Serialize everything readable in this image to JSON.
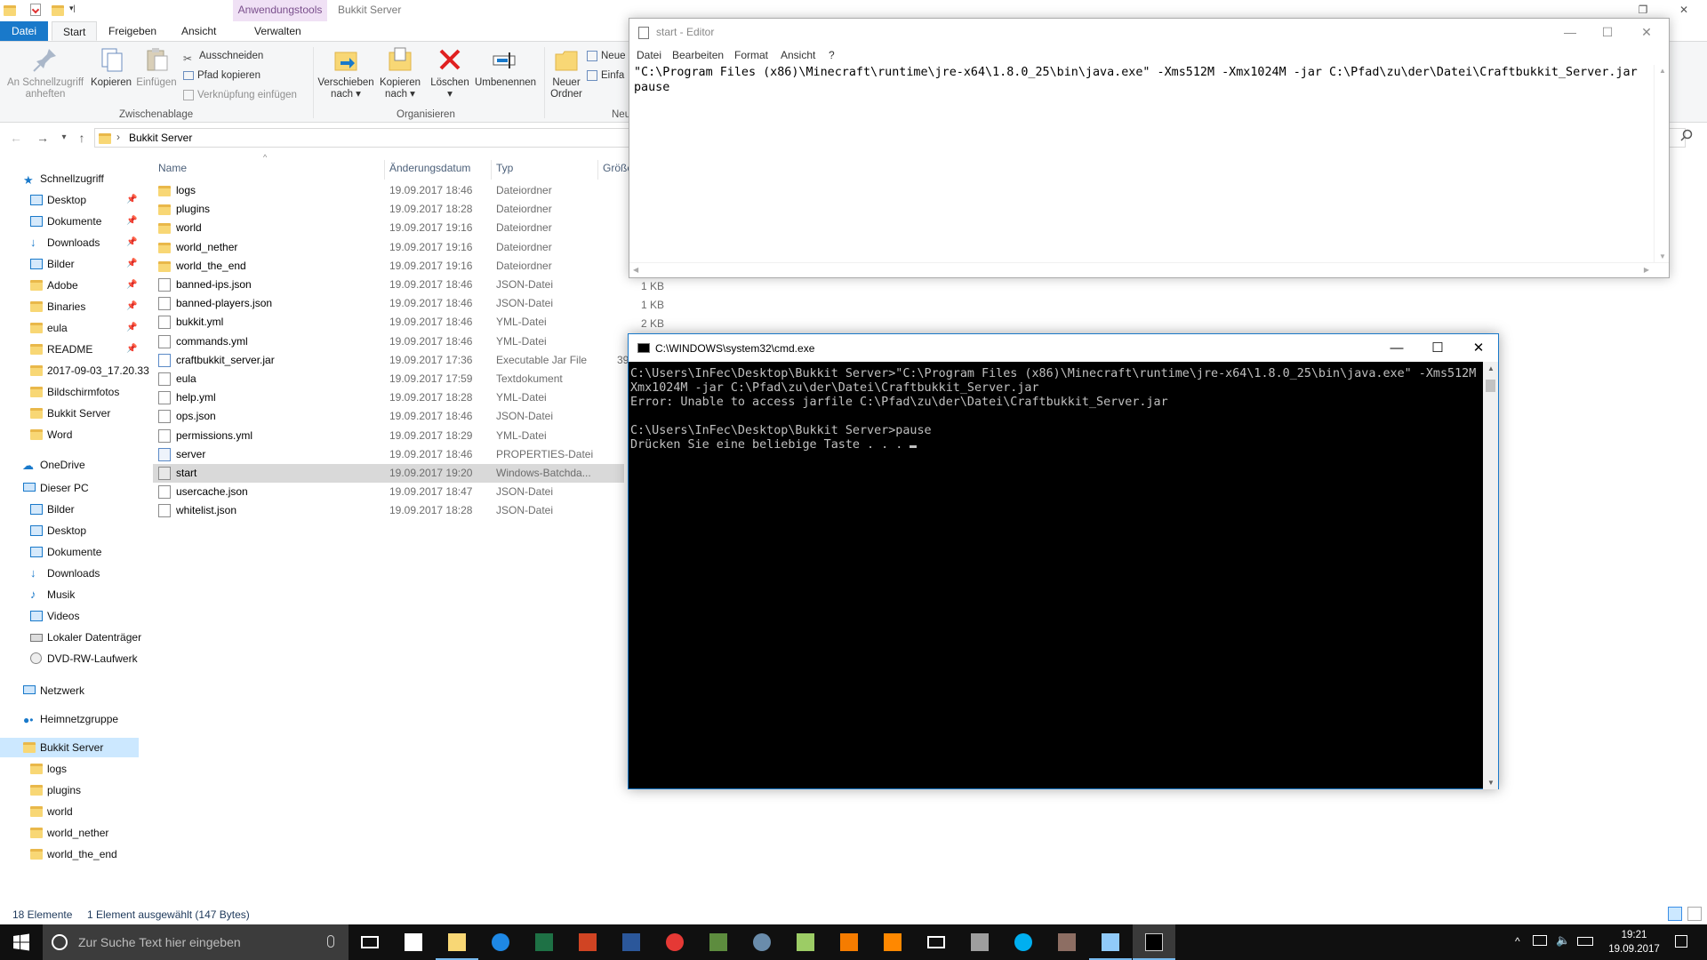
{
  "explorer": {
    "window_title": "Bukkit Server",
    "context_tab": "Anwendungstools",
    "tabs": [
      "Datei",
      "Start",
      "Freigeben",
      "Ansicht",
      "Verwalten"
    ],
    "ribbon": {
      "pin_label": "An Schnellzugriff anheften",
      "copy_label": "Kopieren",
      "paste_label": "Einfügen",
      "cut_label": "Ausschneiden",
      "copy_path_label": "Pfad kopieren",
      "paste_shortcut_label": "Verknüpfung einfügen",
      "group_clipboard": "Zwischenablage",
      "move_label": "Verschieben nach",
      "copyto_label": "Kopieren nach",
      "delete_label": "Löschen",
      "rename_label": "Umbenennen",
      "group_organize": "Organisieren",
      "new_folder_label": "Neuer Ordner",
      "new_item_label": "Neue",
      "easy_access_label": "Einfa",
      "group_new": "Neu"
    },
    "address": {
      "crumb": "Bukkit Server"
    },
    "columns": {
      "name": "Name",
      "date": "Änderungsdatum",
      "type": "Typ",
      "size": "Größe"
    },
    "files": [
      {
        "name": "logs",
        "date": "19.09.2017 18:46",
        "type": "Dateiordner",
        "icon": "folder-icon"
      },
      {
        "name": "plugins",
        "date": "19.09.2017 18:28",
        "type": "Dateiordner",
        "icon": "folder-icon"
      },
      {
        "name": "world",
        "date": "19.09.2017 19:16",
        "type": "Dateiordner",
        "icon": "folder-icon"
      },
      {
        "name": "world_nether",
        "date": "19.09.2017 19:16",
        "type": "Dateiordner",
        "icon": "folder-icon"
      },
      {
        "name": "world_the_end",
        "date": "19.09.2017 19:16",
        "type": "Dateiordner",
        "icon": "folder-icon"
      },
      {
        "name": "banned-ips.json",
        "date": "19.09.2017 18:46",
        "type": "JSON-Datei",
        "icon": "file-icon"
      },
      {
        "name": "banned-players.json",
        "date": "19.09.2017 18:46",
        "type": "JSON-Datei",
        "icon": "file-icon"
      },
      {
        "name": "bukkit.yml",
        "date": "19.09.2017 18:46",
        "type": "YML-Datei",
        "icon": "file-icon"
      },
      {
        "name": "commands.yml",
        "date": "19.09.2017 18:46",
        "type": "YML-Datei",
        "icon": "file-icon"
      },
      {
        "name": "craftbukkit_server.jar",
        "date": "19.09.2017 17:36",
        "type": "Executable Jar File",
        "icon": "jar-icon"
      },
      {
        "name": "eula",
        "date": "19.09.2017 17:59",
        "type": "Textdokument",
        "icon": "file-icon"
      },
      {
        "name": "help.yml",
        "date": "19.09.2017 18:28",
        "type": "YML-Datei",
        "icon": "file-icon"
      },
      {
        "name": "ops.json",
        "date": "19.09.2017 18:46",
        "type": "JSON-Datei",
        "icon": "file-icon"
      },
      {
        "name": "permissions.yml",
        "date": "19.09.2017 18:29",
        "type": "YML-Datei",
        "icon": "file-icon"
      },
      {
        "name": "server",
        "date": "19.09.2017 18:46",
        "type": "PROPERTIES-Datei",
        "icon": "settings-file-icon"
      },
      {
        "name": "start",
        "date": "19.09.2017 19:20",
        "type": "Windows-Batchda...",
        "icon": "batch-file-icon"
      },
      {
        "name": "usercache.json",
        "date": "19.09.2017 18:47",
        "type": "JSON-Datei",
        "icon": "file-icon"
      },
      {
        "name": "whitelist.json",
        "date": "19.09.2017 18:28",
        "type": "JSON-Datei",
        "icon": "file-icon"
      }
    ],
    "sizes": [
      "1 KB",
      "1 KB",
      "2 KB",
      "39"
    ],
    "nav": {
      "quick_access": "Schnellzugriff",
      "quick_items": [
        "Desktop",
        "Dokumente",
        "Downloads",
        "Bilder",
        "Adobe",
        "Binaries",
        "eula",
        "README",
        "2017-09-03_17.20.33",
        "Bildschirmfotos",
        "Bukkit Server",
        "Word"
      ],
      "onedrive": "OneDrive",
      "this_pc": "Dieser PC",
      "pc_items": [
        "Bilder",
        "Desktop",
        "Dokumente",
        "Downloads",
        "Musik",
        "Videos",
        "Lokaler Datenträger",
        "DVD-RW-Laufwerk"
      ],
      "network": "Netzwerk",
      "homegroup": "Heimnetzgruppe",
      "current": "Bukkit Server",
      "current_children": [
        "logs",
        "plugins",
        "world",
        "world_nether",
        "world_the_end"
      ]
    },
    "status": {
      "count": "18 Elemente",
      "selection": "1 Element ausgewählt (147 Bytes)"
    }
  },
  "notepad": {
    "title": "start - Editor",
    "menu": [
      "Datei",
      "Bearbeiten",
      "Format",
      "Ansicht",
      "?"
    ],
    "content": "\"C:\\Program Files (x86)\\Minecraft\\runtime\\jre-x64\\1.8.0_25\\bin\\java.exe\" -Xms512M -Xmx1024M -jar C:\\Pfad\\zu\\der\\Datei\\Craftbukkit_Server.jar\npause"
  },
  "cmd": {
    "title": "C:\\WINDOWS\\system32\\cmd.exe",
    "output": "C:\\Users\\InFec\\Desktop\\Bukkit Server>\"C:\\Program Files (x86)\\Minecraft\\runtime\\jre-x64\\1.8.0_25\\bin\\java.exe\" -Xms512M -\nXmx1024M -jar C:\\Pfad\\zu\\der\\Datei\\Craftbukkit_Server.jar\nError: Unable to access jarfile C:\\Pfad\\zu\\der\\Datei\\Craftbukkit_Server.jar\n\nC:\\Users\\InFec\\Desktop\\Bukkit Server>pause\nDrücken Sie eine beliebige Taste . . . "
  },
  "taskbar": {
    "search_placeholder": "Zur Suche Text hier eingeben",
    "time": "19:21",
    "date": "19.09.2017",
    "apps": [
      "task-view-icon",
      "store-icon",
      "file-explorer-icon",
      "edge-icon",
      "excel-icon",
      "powerpoint-icon",
      "word-icon",
      "chrome-icon",
      "minecraft-icon",
      "steam-icon",
      "notepadpp-icon",
      "media-player-icon",
      "vlc-icon",
      "mail-icon",
      "tool-icon",
      "skype-icon",
      "minecraft-launcher-icon",
      "notepad-icon",
      "cmd-icon"
    ]
  },
  "colors": {
    "accent": "#1979ca",
    "context_tab": "#f0e1f5",
    "selection": "#cce8ff",
    "taskbar": "#101010",
    "console_text": "#c0c0c0"
  }
}
